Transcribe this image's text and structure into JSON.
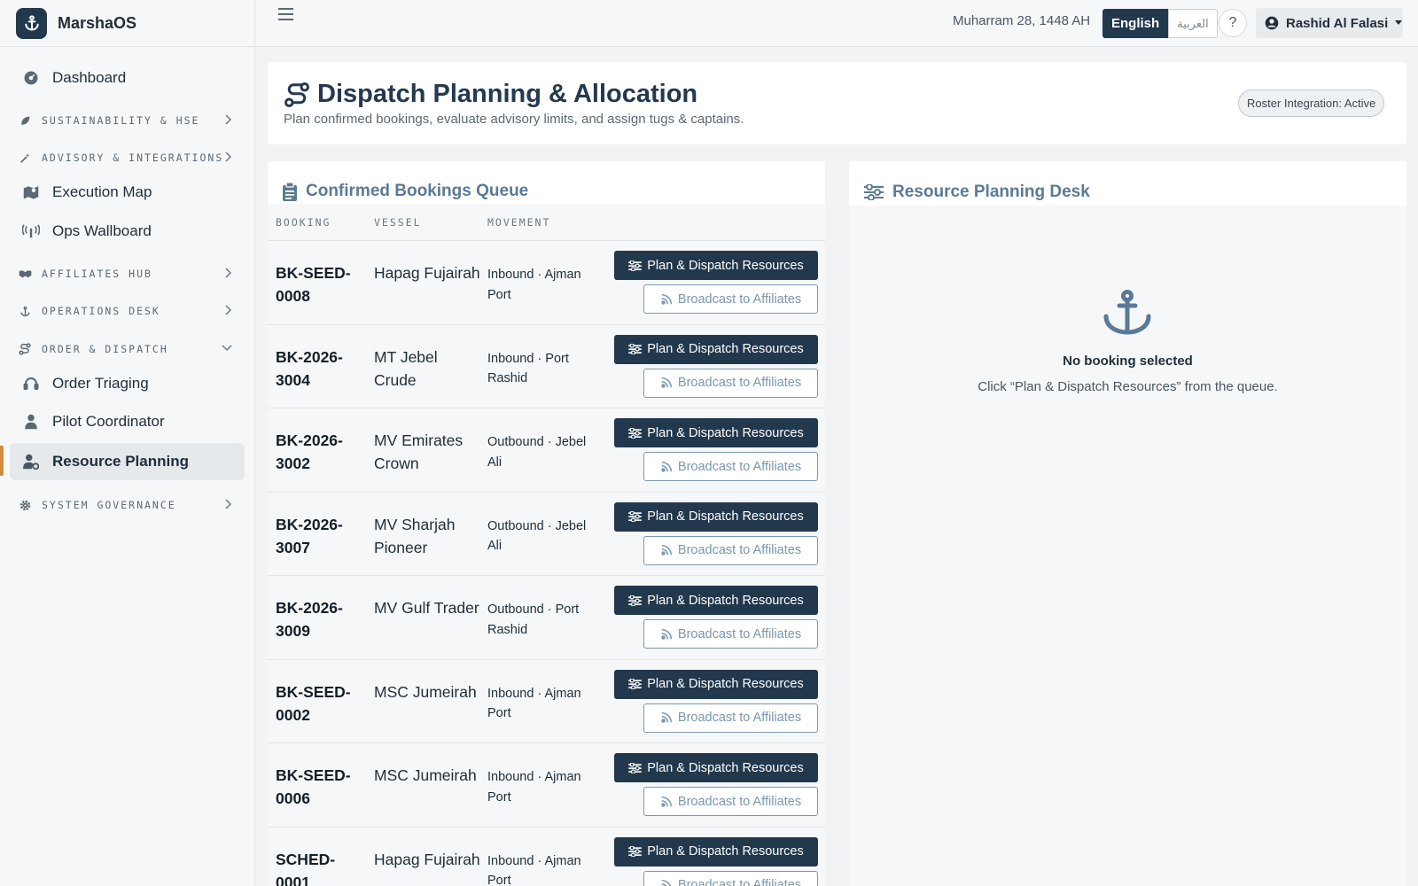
{
  "app": {
    "name": "MarshaOS"
  },
  "sidebar": {
    "dashboard": "Dashboard",
    "sustainability": "SUSTAINABILITY & HSE",
    "advisory": "ADVISORY & INTEGRATIONS",
    "execution_map": "Execution Map",
    "ops_wallboard": "Ops Wallboard",
    "affiliates": "AFFILIATES HUB",
    "operations": "OPERATIONS DESK",
    "order_dispatch": "ORDER & DISPATCH",
    "order_triaging": "Order Triaging",
    "pilot_coordinator": "Pilot Coordinator",
    "resource_planning": "Resource Planning",
    "governance": "SYSTEM GOVERNANCE"
  },
  "topbar": {
    "hijri_date": "Muharram 28, 1448 AH",
    "lang_en": "English",
    "lang_ar": "العربية",
    "help": "?",
    "user_name": "Rashid Al Falasi"
  },
  "page": {
    "title": "Dispatch Planning & Allocation",
    "subtitle": "Plan confirmed bookings, evaluate advisory limits, and assign tugs & captains.",
    "roster_badge": "Roster Integration: Active"
  },
  "queue": {
    "title": "Confirmed Bookings Queue",
    "columns": {
      "booking": "BOOKING",
      "vessel": "VESSEL",
      "movement": "MOVEMENT"
    },
    "plan_label": "Plan & Dispatch Resources",
    "broadcast_label": "Broadcast to Affiliates",
    "rows": [
      {
        "booking": "BK-SEED-0008",
        "vessel": "Hapag Fujairah",
        "movement": "Inbound · Ajman Port"
      },
      {
        "booking": "BK-2026-3004",
        "vessel": "MT Jebel Crude",
        "movement": "Inbound · Port Rashid"
      },
      {
        "booking": "BK-2026-3002",
        "vessel": "MV Emirates Crown",
        "movement": "Outbound · Jebel Ali"
      },
      {
        "booking": "BK-2026-3007",
        "vessel": "MV Sharjah Pioneer",
        "movement": "Outbound · Jebel Ali"
      },
      {
        "booking": "BK-2026-3009",
        "vessel": "MV Gulf Trader",
        "movement": "Outbound · Port Rashid"
      },
      {
        "booking": "BK-SEED-0002",
        "vessel": "MSC Jumeirah",
        "movement": "Inbound · Ajman Port"
      },
      {
        "booking": "BK-SEED-0006",
        "vessel": "MSC Jumeirah",
        "movement": "Inbound · Ajman Port"
      },
      {
        "booking": "SCHED-0001",
        "vessel": "Hapag Fujairah",
        "movement": "Inbound · Ajman Port"
      }
    ]
  },
  "resource": {
    "title": "Resource Planning Desk",
    "empty_title": "No booking selected",
    "empty_subtitle": "Click “Plan & Dispatch Resources” from the queue."
  }
}
